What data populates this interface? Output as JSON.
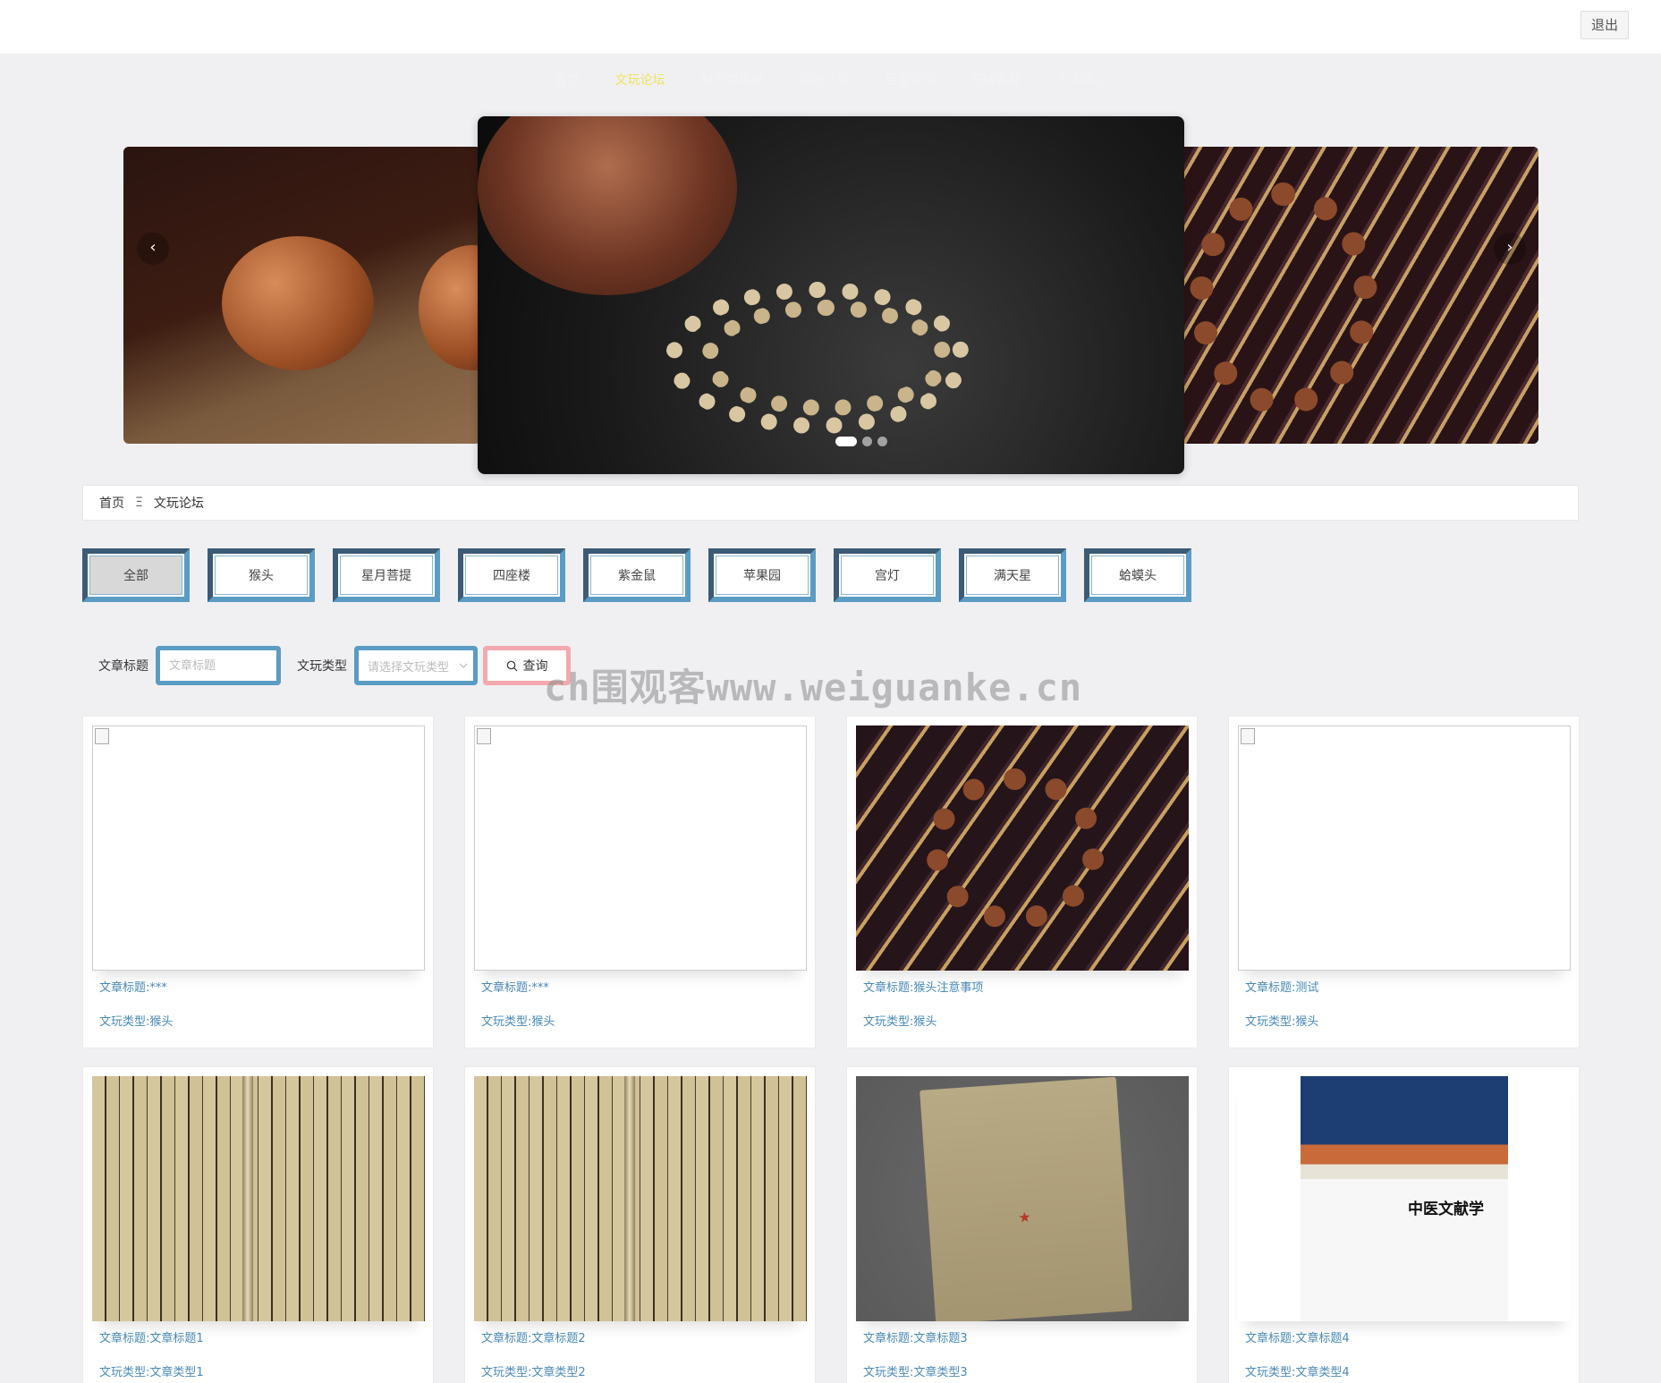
{
  "header": {
    "logout_label": "退出"
  },
  "nav": {
    "items": [
      {
        "label": "首页",
        "active": false
      },
      {
        "label": "文玩论坛",
        "active": true
      },
      {
        "label": "知识库视频",
        "active": false
      },
      {
        "label": "系统公告",
        "active": false
      },
      {
        "label": "后台管理",
        "active": false
      },
      {
        "label": "在线客服",
        "active": false
      },
      {
        "label": "个人中心",
        "active": false
      }
    ],
    "active_color": "#f0e35a"
  },
  "carousel": {
    "prev_icon": "‹",
    "next_icon": "›",
    "slides": 3,
    "active_index": 0
  },
  "breadcrumb": {
    "home": "首页",
    "separator": "Ξ",
    "current": "文玩论坛"
  },
  "categories": [
    {
      "label": "全部",
      "active": true
    },
    {
      "label": "猴头",
      "active": false
    },
    {
      "label": "星月菩提",
      "active": false
    },
    {
      "label": "四座楼",
      "active": false
    },
    {
      "label": "紫金鼠",
      "active": false
    },
    {
      "label": "苹果园",
      "active": false
    },
    {
      "label": "宫灯",
      "active": false
    },
    {
      "label": "满天星",
      "active": false
    },
    {
      "label": "蛤蟆头",
      "active": false
    }
  ],
  "search": {
    "title_label": "文章标题",
    "title_placeholder": "文章标题",
    "type_label": "文玩类型",
    "type_placeholder": "请选择文玩类型",
    "query_label": "查询"
  },
  "watermark": "ch围观客www.weiguanke.cn",
  "articles": [
    {
      "title": "文章标题:***",
      "type": "文玩类型:猴头",
      "image": "blank"
    },
    {
      "title": "文章标题:***",
      "type": "文玩类型:猴头",
      "image": "blank"
    },
    {
      "title": "文章标题:猴头注意事项",
      "type": "文玩类型:猴头",
      "image": "bracelet"
    },
    {
      "title": "文章标题:测试",
      "type": "文玩类型:猴头",
      "image": "blank"
    },
    {
      "title": "文章标题:文章标题1",
      "type": "文玩类型:文章类型1",
      "image": "old-book"
    },
    {
      "title": "文章标题:文章标题2",
      "type": "文玩类型:文章类型2",
      "image": "old-book"
    },
    {
      "title": "文章标题:文章标题3",
      "type": "文玩类型:文章类型3",
      "image": "red-book"
    },
    {
      "title": "文章标题:文章标题4",
      "type": "文玩类型:文章类型4",
      "image": "textbook"
    }
  ],
  "book_cover_title": "中医文献学",
  "colors": {
    "accent_blue": "#5a9cc4",
    "link_blue": "#4a8ab8",
    "query_border": "#f3a9ad"
  }
}
